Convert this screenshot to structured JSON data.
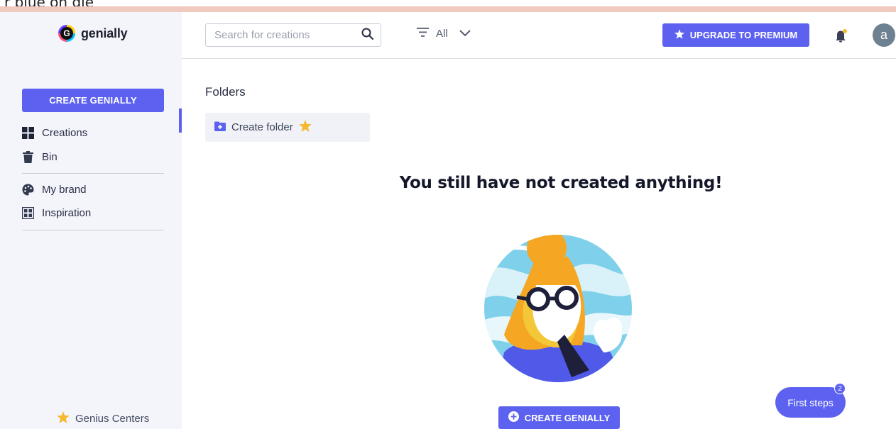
{
  "top_strip_text": "r plue on gle",
  "brand": {
    "name": "genially"
  },
  "sidebar": {
    "create_label": "CREATE GENIALLY",
    "items": [
      {
        "label": "Creations",
        "icon": "grid-icon"
      },
      {
        "label": "Bin",
        "icon": "trash-icon"
      },
      {
        "label": "My brand",
        "icon": "palette-icon"
      },
      {
        "label": "Inspiration",
        "icon": "gallery-icon"
      }
    ],
    "footer_label": "Genius Centers"
  },
  "header": {
    "search_placeholder": "Search for creations",
    "filter_label": "All",
    "upgrade_label": "UPGRADE TO PREMIUM",
    "avatar_letter": "a"
  },
  "main": {
    "folders_title": "Folders",
    "create_folder_label": "Create folder",
    "empty_title": "You still have not created anything!",
    "cta_label": "CREATE GENIALLY"
  },
  "first_steps": {
    "label": "First steps",
    "count": "2"
  },
  "colors": {
    "accent": "#5c62ef",
    "star": "#f5b82e",
    "sidebar_bg": "#f3f5fb"
  }
}
